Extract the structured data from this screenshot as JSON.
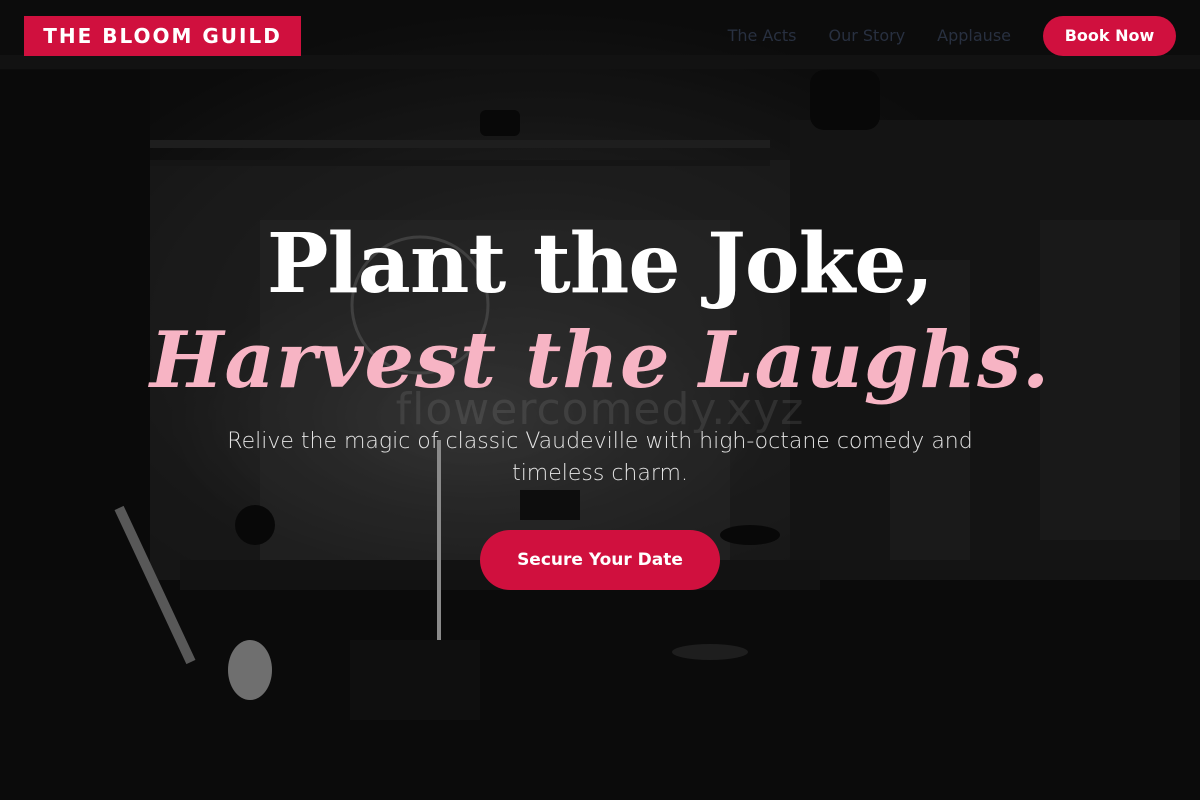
{
  "header": {
    "logo_text": "THE BLOOM GUILD",
    "nav": [
      {
        "label": "The Acts"
      },
      {
        "label": "Our Story"
      },
      {
        "label": "Applause"
      }
    ],
    "book_button": "Book Now"
  },
  "hero": {
    "headline_line1": "Plant the Joke,",
    "headline_line2": "Harvest the Laughs.",
    "subtitle": "Relive the magic of classic Vaudeville with high-octane comedy and timeless charm.",
    "cta_label": "Secure Your Date",
    "watermark": "flowercomedy.xyz",
    "background_image": "dark stage with spotlight, microphone stand and guitar"
  },
  "colors": {
    "accent": "#d0103e",
    "headline": "#ffffff",
    "headline_italic": "#f7b4c4",
    "nav_text": "#283040"
  }
}
